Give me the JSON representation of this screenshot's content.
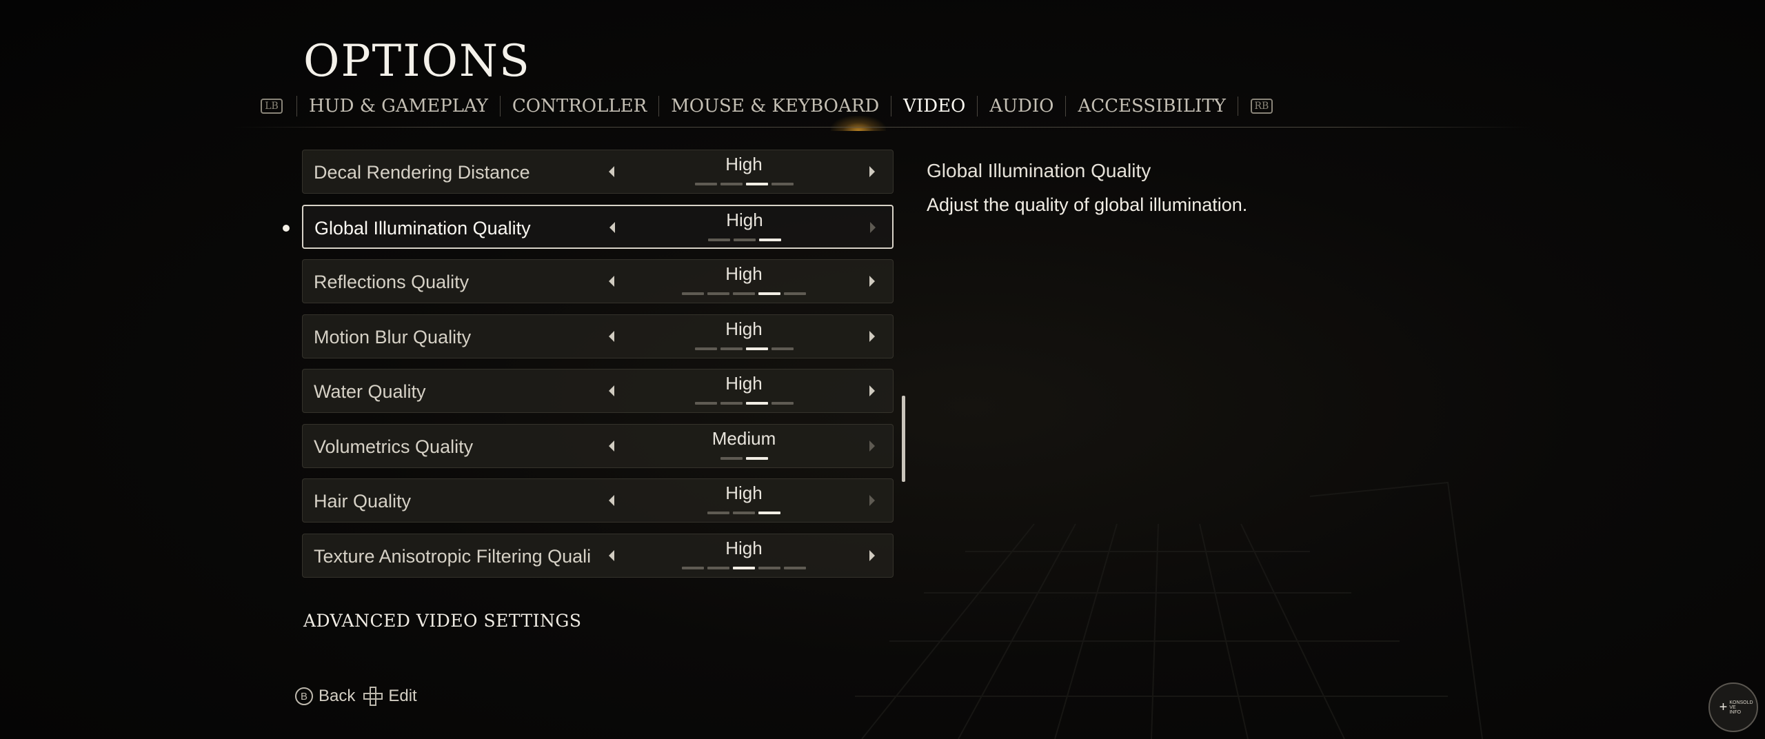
{
  "header": {
    "title": "OPTIONS",
    "left_bumper": "LB",
    "right_bumper": "RB",
    "tabs": [
      {
        "label": "HUD & GAMEPLAY",
        "active": false
      },
      {
        "label": "CONTROLLER",
        "active": false
      },
      {
        "label": "MOUSE & KEYBOARD",
        "active": false
      },
      {
        "label": "VIDEO",
        "active": true
      },
      {
        "label": "AUDIO",
        "active": false
      },
      {
        "label": "ACCESSIBILITY",
        "active": false
      }
    ]
  },
  "settings": [
    {
      "label": "Decal Rendering Distance",
      "value": "High",
      "levels": 4,
      "level": 3,
      "selected": false,
      "can_increase": true
    },
    {
      "label": "Global Illumination Quality",
      "value": "High",
      "levels": 3,
      "level": 3,
      "selected": true,
      "can_increase": false
    },
    {
      "label": "Reflections Quality",
      "value": "High",
      "levels": 5,
      "level": 4,
      "selected": false,
      "can_increase": true
    },
    {
      "label": "Motion Blur Quality",
      "value": "High",
      "levels": 4,
      "level": 3,
      "selected": false,
      "can_increase": true
    },
    {
      "label": "Water Quality",
      "value": "High",
      "levels": 4,
      "level": 3,
      "selected": false,
      "can_increase": true
    },
    {
      "label": "Volumetrics Quality",
      "value": "Medium",
      "levels": 2,
      "level": 2,
      "selected": false,
      "can_increase": false
    },
    {
      "label": "Hair Quality",
      "value": "High",
      "levels": 3,
      "level": 3,
      "selected": false,
      "can_increase": false
    },
    {
      "label": "Texture Anisotropic Filtering Quali",
      "value": "High",
      "levels": 5,
      "level": 3,
      "selected": false,
      "can_increase": true
    }
  ],
  "advanced_link": "ADVANCED VIDEO SETTINGS",
  "description": {
    "title": "Global Illumination Quality",
    "text": "Adjust the quality of global illumination."
  },
  "footer": {
    "back_key": "B",
    "back_label": "Back",
    "edit_label": "Edit"
  },
  "badge": {
    "text": "KONSOLD VE INFO"
  },
  "colors": {
    "accent_glow": "#d69628",
    "selected_border": "#d8d3c8",
    "pip_on": "#f1ede4",
    "pip_off": "#5f5b53"
  }
}
